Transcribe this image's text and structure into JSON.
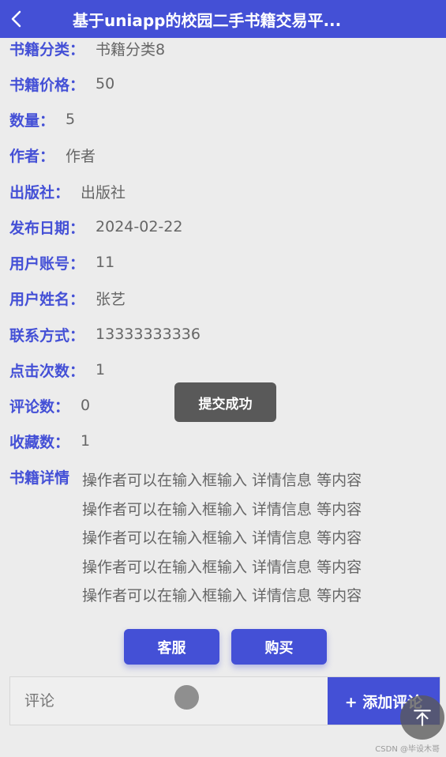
{
  "header": {
    "title": "基于uniapp的校园二手书籍交易平..."
  },
  "fields": [
    {
      "label": "书籍分类：",
      "value": "书籍分类8"
    },
    {
      "label": "书籍价格：",
      "value": "50"
    },
    {
      "label": "数量：",
      "value": "5"
    },
    {
      "label": "作者：",
      "value": "作者"
    },
    {
      "label": "出版社：",
      "value": "出版社"
    },
    {
      "label": "发布日期：",
      "value": "2024-02-22"
    },
    {
      "label": "用户账号：",
      "value": "11"
    },
    {
      "label": "用户姓名：",
      "value": "张艺"
    },
    {
      "label": "联系方式：",
      "value": "13333333336"
    },
    {
      "label": "点击次数：",
      "value": "1"
    },
    {
      "label": "评论数：",
      "value": "0"
    },
    {
      "label": "收藏数：",
      "value": "1"
    }
  ],
  "detail": {
    "label": "书籍详情",
    "lines": [
      "操作者可以在输入框输入 详情信息 等内容",
      "操作者可以在输入框输入 详情信息 等内容",
      "操作者可以在输入框输入 详情信息 等内容",
      "操作者可以在输入框输入 详情信息 等内容",
      "操作者可以在输入框输入 详情信息 等内容"
    ]
  },
  "toast": {
    "text": "提交成功"
  },
  "buttons": {
    "service": "客服",
    "buy": "购买"
  },
  "comment": {
    "placeholder": "评论",
    "add_label": "+ 添加评论"
  },
  "watermark": "CSDN @毕设木哥",
  "icons": {
    "back": "chevron-left-icon",
    "scroll_top": "arrow-up-icon"
  },
  "colors": {
    "accent": "#4450d6",
    "background": "#ececec",
    "toast": "#595959"
  }
}
